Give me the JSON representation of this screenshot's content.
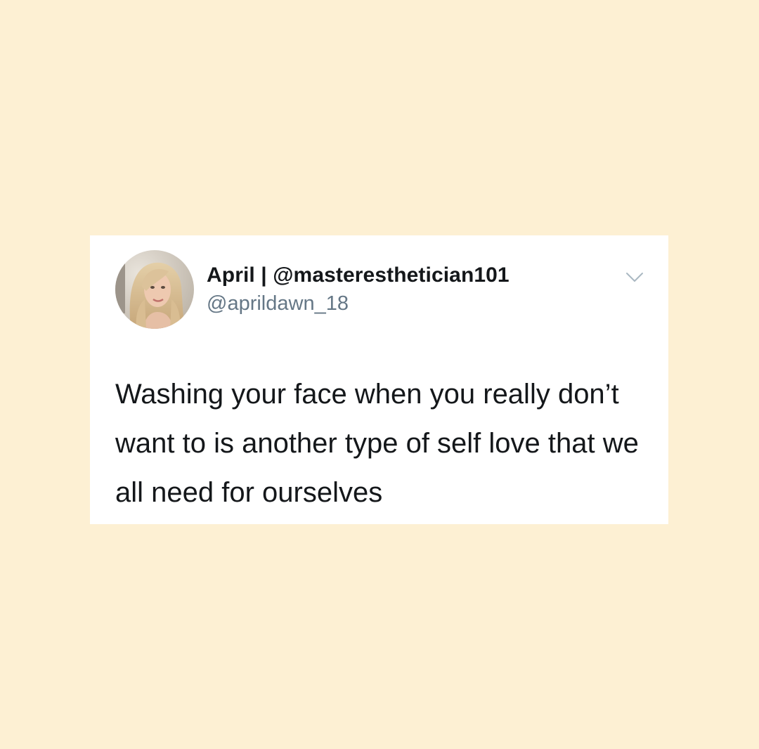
{
  "tweet": {
    "author": {
      "display_name": "April | @masteresthetician101",
      "handle": "@aprildawn_18",
      "avatar_icon": "profile-photo"
    },
    "text": "Washing your face when you really don’t want to is another type of self love that we all need for ourselves",
    "menu_icon": "chevron-down-icon"
  },
  "colors": {
    "background": "#fdf0d3",
    "card": "#ffffff",
    "primary_text": "#14171a",
    "secondary_text": "#657786",
    "chevron": "#aab8c2"
  }
}
